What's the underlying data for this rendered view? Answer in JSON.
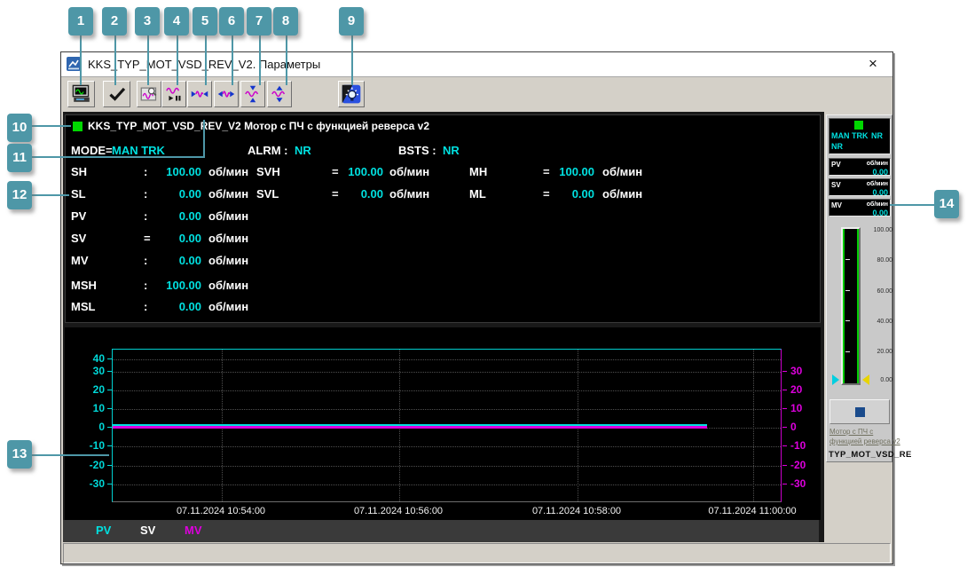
{
  "callouts": {
    "badges": [
      "1",
      "2",
      "3",
      "4",
      "5",
      "6",
      "7",
      "8",
      "9",
      "10",
      "11",
      "12",
      "13",
      "14"
    ]
  },
  "window": {
    "title": "KKS_TYP_MOT_VSD_REV_V2. Параметры",
    "close_glyph": "×"
  },
  "toolbar": {
    "button_icons": [
      "print-icon",
      "accept-check-icon",
      "chart-snapshot-icon",
      "trend-start-pause-icon",
      "time-zoom-in-icon",
      "time-zoom-out-icon",
      "value-zoom-in-icon",
      "value-zoom-out-icon",
      "theme-lamp-icon"
    ]
  },
  "params": {
    "header": "KKS_TYP_MOT_VSD_REV_V2 Мотор с ПЧ с функцией реверса v2",
    "mode_label": "MODE=",
    "mode_value": "MAN TRK",
    "alrm_label": "ALRM :",
    "alrm_value": "NR",
    "bsts_label": "BSTS :",
    "bsts_value": "NR",
    "col1": [
      {
        "label": "SH",
        "sep": ":",
        "value": "100.00",
        "unit": "об/мин"
      },
      {
        "label": "SL",
        "sep": ":",
        "value": "0.00",
        "unit": "об/мин"
      },
      {
        "label": "PV",
        "sep": ":",
        "value": "0.00",
        "unit": "об/мин"
      },
      {
        "label": "SV",
        "sep": "=",
        "value": "0.00",
        "unit": "об/мин"
      },
      {
        "label": "MV",
        "sep": ":",
        "value": "0.00",
        "unit": "об/мин"
      },
      {
        "label": "MSH",
        "sep": ":",
        "value": "100.00",
        "unit": "об/мин"
      },
      {
        "label": "MSL",
        "sep": ":",
        "value": "0.00",
        "unit": "об/мин"
      }
    ],
    "col2": [
      {
        "label": "SVH",
        "sep": "=",
        "value": "100.00",
        "unit": "об/мин"
      },
      {
        "label": "SVL",
        "sep": "=",
        "value": "0.00",
        "unit": "об/мин"
      }
    ],
    "col3": [
      {
        "label": "MH",
        "sep": "=",
        "value": "100.00",
        "unit": "об/мин"
      },
      {
        "label": "ML",
        "sep": "=",
        "value": "0.00",
        "unit": "об/мин"
      }
    ]
  },
  "chart_data": {
    "type": "line",
    "x_ticks": [
      "07.11.2024 10:54:00",
      "07.11.2024 10:56:00",
      "07.11.2024 10:58:00",
      "07.11.2024 11:00:00"
    ],
    "left_axis": {
      "ticks": [
        "40",
        "30",
        "20",
        "10",
        "0",
        "-10",
        "-20",
        "-30"
      ],
      "range": [
        -41,
        42
      ],
      "color": "#00d8d8"
    },
    "right_axis": {
      "ticks": [
        "30",
        "20",
        "10",
        "0",
        "-10",
        "-20",
        "-30"
      ],
      "range": [
        -41,
        42
      ],
      "color": "#dd00dd"
    },
    "series": [
      {
        "name": "PV",
        "color": "#00e0e0",
        "values": [
          0,
          0
        ]
      },
      {
        "name": "SV",
        "color": "#ffffff",
        "values": [
          0,
          0
        ]
      },
      {
        "name": "MV",
        "color": "#dd00dd",
        "values": [
          0,
          0
        ]
      }
    ],
    "legend": [
      "PV",
      "SV",
      "MV"
    ],
    "grid": "dotted"
  },
  "faceplate": {
    "mode": "MAN TRK",
    "alarm": "NR",
    "bsts": "NR",
    "values": [
      {
        "label": "PV",
        "unit": "об/мин",
        "value": "0.00"
      },
      {
        "label": "SV",
        "unit": "об/мин",
        "value": "0.00"
      },
      {
        "label": "MV",
        "unit": "об/мин",
        "value": "0.00"
      }
    ],
    "gauge_scale": [
      "100.00",
      "80.00",
      "60.00",
      "40.00",
      "20.00",
      "0.00"
    ],
    "desc_line1": "Мотор с ПЧ с",
    "desc_line2": "функцией реверса v2",
    "kks_short": "TYP_MOT_VSD_RE"
  }
}
